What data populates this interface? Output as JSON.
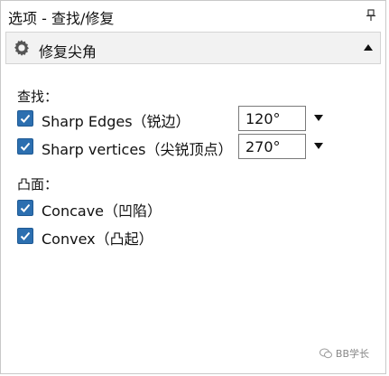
{
  "titlebar": {
    "title": "选项 - 查找/修复",
    "pin_icon": "pin-icon"
  },
  "section": {
    "label": "修复尖角",
    "icon": "gear-icon",
    "toggle_icon": "collapse-up-icon"
  },
  "find": {
    "title": "查找：",
    "items": [
      {
        "label": "Sharp Edges（锐边）",
        "checked": true,
        "value": "120°"
      },
      {
        "label": "Sharp vertices（尖锐顶点）",
        "checked": true,
        "value": "270°"
      }
    ]
  },
  "convex_concave": {
    "title": "凸面：",
    "items": [
      {
        "label": "Concave（凹陷）",
        "checked": true
      },
      {
        "label": "Convex（凸起）",
        "checked": true
      }
    ]
  },
  "watermark": {
    "text": "BB学长"
  },
  "colors": {
    "checkbox": "#2c6fb0",
    "header_bg": "#f2f2f2"
  }
}
